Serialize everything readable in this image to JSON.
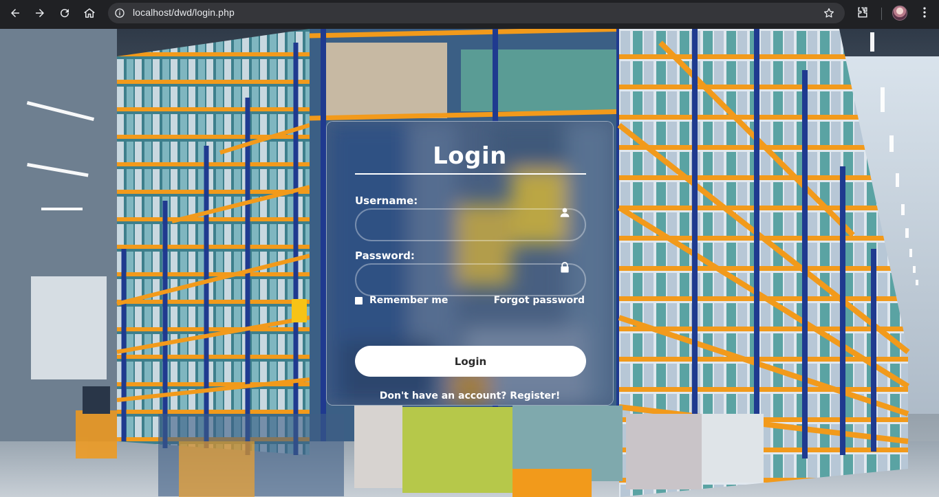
{
  "browser": {
    "url": "localhost/dwd/login.php",
    "icons": [
      "back-arrow-icon",
      "forward-arrow-icon",
      "reload-icon",
      "home-icon",
      "site-info-icon",
      "bookmark-star-icon",
      "extensions-icon",
      "profile-avatar",
      "kebab-menu-icon"
    ]
  },
  "login": {
    "title": "Login",
    "username_label": "Username:",
    "username_value": "",
    "password_label": "Password:",
    "password_value": "",
    "remember_label": "Remember me",
    "forgot_label": "Forgot password",
    "submit_label": "Login",
    "register_text": "Don't have an account? Register!"
  },
  "colors": {
    "card_border": "#ffffff",
    "button_bg": "#ffffff",
    "button_text": "#2b2b2b",
    "shelf_orange": "#f29a1b",
    "shelf_blue": "#1f3a8f"
  }
}
